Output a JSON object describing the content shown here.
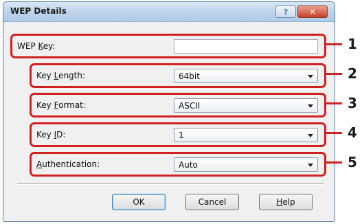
{
  "window": {
    "title": "WEP Details",
    "help_glyph": "?",
    "close_glyph": "✕"
  },
  "fields": [
    {
      "label_pre": "WEP ",
      "label_key": "K",
      "label_post": "ey:",
      "value": "",
      "callout": "1"
    },
    {
      "label_pre": "Key ",
      "label_key": "L",
      "label_post": "ength:",
      "value": "64bit",
      "callout": "2"
    },
    {
      "label_pre": "Key ",
      "label_key": "F",
      "label_post": "ormat:",
      "value": "ASCII",
      "callout": "3"
    },
    {
      "label_pre": "Key ",
      "label_key": "I",
      "label_post": "D:",
      "value": "1",
      "callout": "4"
    },
    {
      "label_pre": "",
      "label_key": "A",
      "label_post": "uthentication:",
      "value": "Auto",
      "callout": "5"
    }
  ],
  "buttons": {
    "ok": "OK",
    "cancel": "Cancel",
    "help_key": "H",
    "help_rest": "elp"
  },
  "colors": {
    "highlight": "#d0201f",
    "title_bar": "#bcd3ea"
  }
}
